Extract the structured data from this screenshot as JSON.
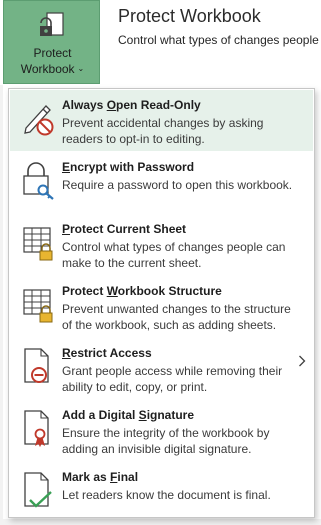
{
  "protect_button": {
    "label_line1": "Protect",
    "label_line2": "Workbook",
    "caret": "⌄",
    "icon": "lock-document-icon"
  },
  "header": {
    "title": "Protect Workbook",
    "description": "Control what types of changes people"
  },
  "menu": {
    "items": [
      {
        "pre": "Always ",
        "key": "O",
        "post": "pen Read-Only",
        "description": "Prevent accidental changes by asking readers to opt-in to editing.",
        "icon": "pencil-no-edit-icon"
      },
      {
        "pre": "",
        "key": "E",
        "post": "ncrypt with Password",
        "description": "Require a password to open this workbook.",
        "icon": "lock-key-icon"
      },
      {
        "pre": "",
        "key": "P",
        "post": "rotect Current Sheet",
        "description": "Control what types of changes people can make to the current sheet.",
        "icon": "sheet-lock-icon"
      },
      {
        "pre": "Protect ",
        "key": "W",
        "post": "orkbook Structure",
        "description": "Prevent unwanted changes to the structure of the workbook, such as adding sheets.",
        "icon": "workbook-structure-lock-icon"
      },
      {
        "pre": "",
        "key": "R",
        "post": "estrict Access",
        "description": "Grant people access while removing their ability to edit, copy, or print.",
        "icon": "document-restrict-icon",
        "has_submenu": true
      },
      {
        "pre": "Add a Digital ",
        "key": "S",
        "post": "ignature",
        "description": "Ensure the integrity of the workbook by adding an invisible digital signature.",
        "icon": "document-ribbon-icon"
      },
      {
        "pre": "Mark as ",
        "key": "F",
        "post": "inal",
        "description": "Let readers know the document is final.",
        "icon": "document-checkmark-icon"
      }
    ]
  },
  "colors": {
    "protect_button_bg": "#73b386",
    "hover_bg": "#e6f1ea",
    "accent_blue": "#2e75b6",
    "lock_gold": "#e8b530",
    "restrict_red": "#c0392b",
    "check_green": "#3aa055"
  }
}
